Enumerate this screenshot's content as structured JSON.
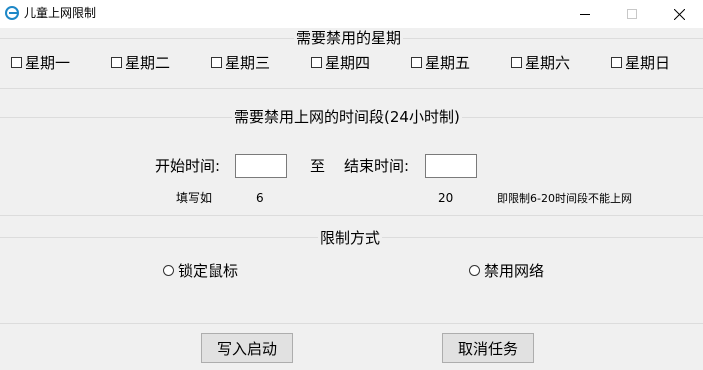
{
  "window": {
    "title": "儿童上网限制"
  },
  "weekdays": {
    "title": "需要禁用的星期",
    "days": [
      "星期一",
      "星期二",
      "星期三",
      "星期四",
      "星期五",
      "星期六",
      "星期日"
    ]
  },
  "timeRange": {
    "title": "需要禁用上网的时间段(24小时制)",
    "start_label": "开始时间:",
    "to_label": "至",
    "end_label": "结束时间:",
    "start_value": "",
    "end_value": "",
    "hint_label": "填写如",
    "hint_start": "6",
    "hint_end": "20",
    "hint_note": "即限制6-20时间段不能上网"
  },
  "method": {
    "title": "限制方式",
    "options": [
      "锁定鼠标",
      "禁用网络"
    ]
  },
  "actions": {
    "write_start": "写入启动",
    "cancel_task": "取消任务"
  },
  "icons": {
    "app": "app-icon",
    "minimize": "minimize-icon",
    "maximize": "maximize-icon",
    "close": "close-icon"
  },
  "colors": {
    "window_bg": "#f0f0f0",
    "titlebar_bg": "#ffffff",
    "icon_blue": "#1e88c7"
  }
}
